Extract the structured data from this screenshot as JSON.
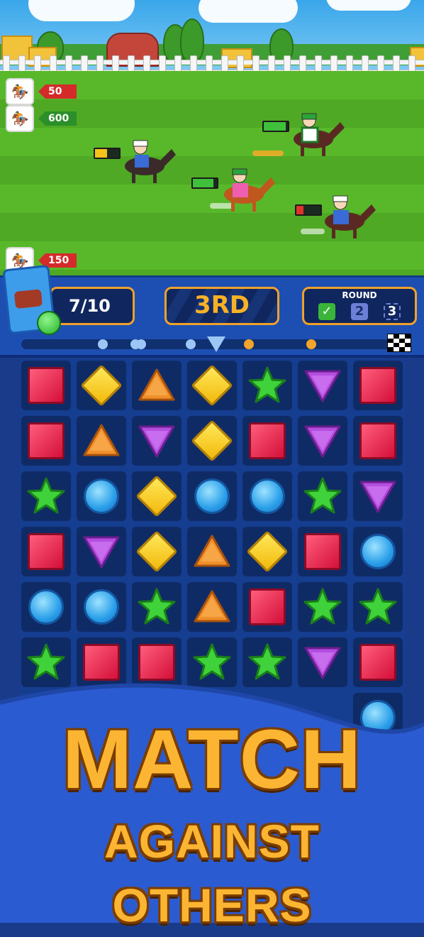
{
  "race": {
    "runners": [
      {
        "name": "runner-1",
        "value": "50",
        "tag_color": "red"
      },
      {
        "name": "runner-2",
        "value": "600",
        "tag_color": "green"
      },
      {
        "name": "runner-3",
        "value": "150",
        "tag_color": "red"
      }
    ]
  },
  "hud": {
    "booster_count": "7/10",
    "rank": "3RD",
    "round_label": "ROUND",
    "round_current": "2",
    "round_next": "3"
  },
  "board": {
    "rows": [
      [
        "red",
        "yellow",
        "orange",
        "yellow",
        "green",
        "purple",
        "red"
      ],
      [
        "red",
        "orange",
        "purple",
        "yellow",
        "red",
        "purple",
        "red"
      ],
      [
        "green",
        "blue",
        "yellow",
        "blue",
        "blue",
        "green",
        "purple"
      ],
      [
        "red",
        "purple",
        "yellow",
        "orange",
        "yellow",
        "red",
        "blue"
      ],
      [
        "blue",
        "blue",
        "green",
        "orange",
        "red",
        "green",
        "green"
      ],
      [
        "green",
        "red",
        "red",
        "green",
        "green",
        "purple",
        "red"
      ],
      [
        "",
        "",
        "",
        "",
        "",
        "",
        "blue"
      ]
    ]
  },
  "promo": {
    "line1": "MATCH",
    "line2": "AGAINST OTHERS"
  },
  "colors": {
    "accent": "#fbb532",
    "hud_bg": "#1d4fb3",
    "board_bg": "#153d90"
  }
}
